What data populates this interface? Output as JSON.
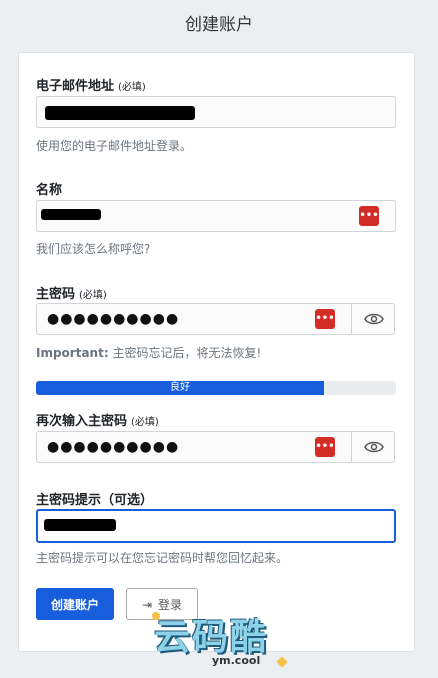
{
  "page": {
    "title": "创建账户"
  },
  "form": {
    "email": {
      "label": "电子邮件地址",
      "required": "(必填)",
      "hint": "使用您的电子邮件地址登录。"
    },
    "name": {
      "label": "名称",
      "hint": "我们应该怎么称呼您?"
    },
    "master_password": {
      "label": "主密码",
      "required": "(必填)",
      "value_masked": "●●●●●●●●●●",
      "hint_bold": "Important:",
      "hint": " 主密码忘记后，将无法恢复!"
    },
    "strength": {
      "label": "良好",
      "fraction": 0.8,
      "color": "#175ddc"
    },
    "confirm_password": {
      "label": "再次输入主密码",
      "required": "(必填)",
      "value_masked": "●●●●●●●●●●"
    },
    "password_hint": {
      "label": "主密码提示（可选）",
      "hint": "主密码提示可以在您忘记密码时帮您回忆起来。"
    },
    "lastpass_icon": "•••"
  },
  "buttons": {
    "create": "创建账户",
    "login": "登录"
  },
  "watermark": {
    "text": "云码酷",
    "sub": "ym.cool"
  },
  "colors": {
    "primary": "#175ddc",
    "lastpass": "#d32d27"
  }
}
